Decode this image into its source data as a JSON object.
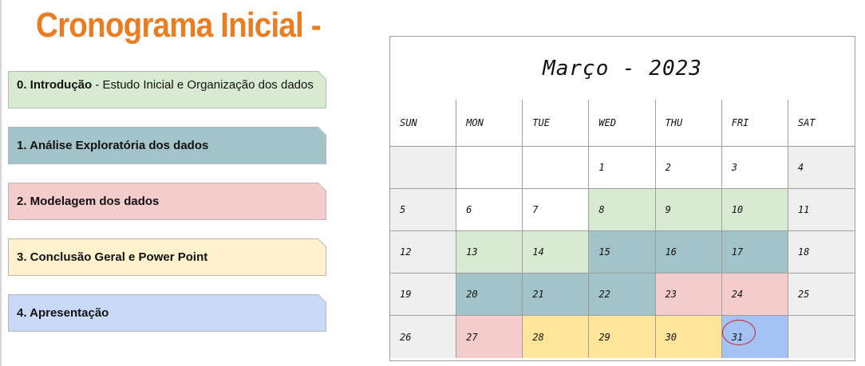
{
  "title": "Cronograma Inicial -",
  "legend": [
    {
      "bold": "0. Introdução",
      "rest": " - Estudo Inicial e Organização dos dados"
    },
    {
      "bold": "1. Análise Exploratória dos dados",
      "rest": ""
    },
    {
      "bold": "2. Modelagem dos dados",
      "rest": ""
    },
    {
      "bold": "3. Conclusão Geral e Power Point",
      "rest": ""
    },
    {
      "bold": "4. Apresentação",
      "rest": ""
    }
  ],
  "colors": {
    "title": "#ea7d22",
    "introducao": "#d9ead3",
    "analise": "#a2c4c9",
    "modelagem": "#f4cccc",
    "conclusao": "#ffe599",
    "apresentacao": "#a4c2f4",
    "weekend": "#efefef"
  },
  "calendar": {
    "month_title": "Março - 2023",
    "day_names": [
      "SUN",
      "MON",
      "TUE",
      "WED",
      "THU",
      "FRI",
      "SAT"
    ],
    "weeks": [
      [
        {
          "d": "",
          "c": "grey"
        },
        {
          "d": "",
          "c": "white"
        },
        {
          "d": "",
          "c": "white"
        },
        {
          "d": "1",
          "c": "white"
        },
        {
          "d": "2",
          "c": "white"
        },
        {
          "d": "3",
          "c": "white"
        },
        {
          "d": "4",
          "c": "grey"
        }
      ],
      [
        {
          "d": "5",
          "c": "grey"
        },
        {
          "d": "6",
          "c": "white"
        },
        {
          "d": "7",
          "c": "white"
        },
        {
          "d": "8",
          "c": "green"
        },
        {
          "d": "9",
          "c": "green"
        },
        {
          "d": "10",
          "c": "green"
        },
        {
          "d": "11",
          "c": "grey"
        }
      ],
      [
        {
          "d": "12",
          "c": "grey"
        },
        {
          "d": "13",
          "c": "green"
        },
        {
          "d": "14",
          "c": "green"
        },
        {
          "d": "15",
          "c": "teal"
        },
        {
          "d": "16",
          "c": "teal"
        },
        {
          "d": "17",
          "c": "teal"
        },
        {
          "d": "18",
          "c": "grey"
        }
      ],
      [
        {
          "d": "19",
          "c": "grey"
        },
        {
          "d": "20",
          "c": "teal"
        },
        {
          "d": "21",
          "c": "teal"
        },
        {
          "d": "22",
          "c": "teal"
        },
        {
          "d": "23",
          "c": "pink"
        },
        {
          "d": "24",
          "c": "pink"
        },
        {
          "d": "25",
          "c": "grey"
        }
      ],
      [
        {
          "d": "26",
          "c": "grey"
        },
        {
          "d": "27",
          "c": "pink"
        },
        {
          "d": "28",
          "c": "yellow"
        },
        {
          "d": "29",
          "c": "yellow"
        },
        {
          "d": "30",
          "c": "yellow"
        },
        {
          "d": "31",
          "c": "blue",
          "circled": true
        },
        {
          "d": "",
          "c": "grey"
        }
      ]
    ]
  }
}
